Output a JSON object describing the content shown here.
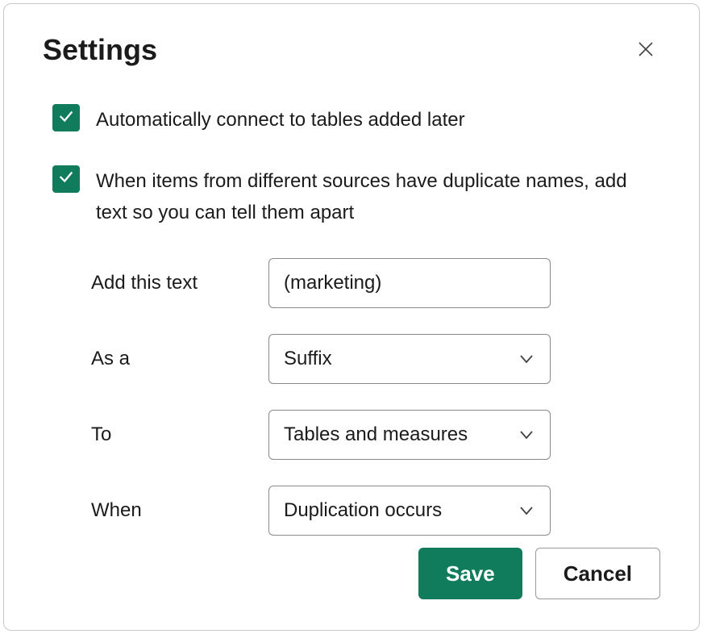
{
  "dialog": {
    "title": "Settings"
  },
  "checkboxes": {
    "auto_connect": {
      "label": "Automatically connect to tables added later",
      "checked": true
    },
    "duplicate_names": {
      "label": "When items from different sources have duplicate names, add text so you can tell them apart",
      "checked": true
    }
  },
  "form": {
    "add_text": {
      "label": "Add this text",
      "value": "(marketing)"
    },
    "as_a": {
      "label": "As a",
      "value": "Suffix"
    },
    "to": {
      "label": "To",
      "value": "Tables and measures"
    },
    "when": {
      "label": "When",
      "value": "Duplication occurs"
    }
  },
  "buttons": {
    "save": "Save",
    "cancel": "Cancel"
  }
}
